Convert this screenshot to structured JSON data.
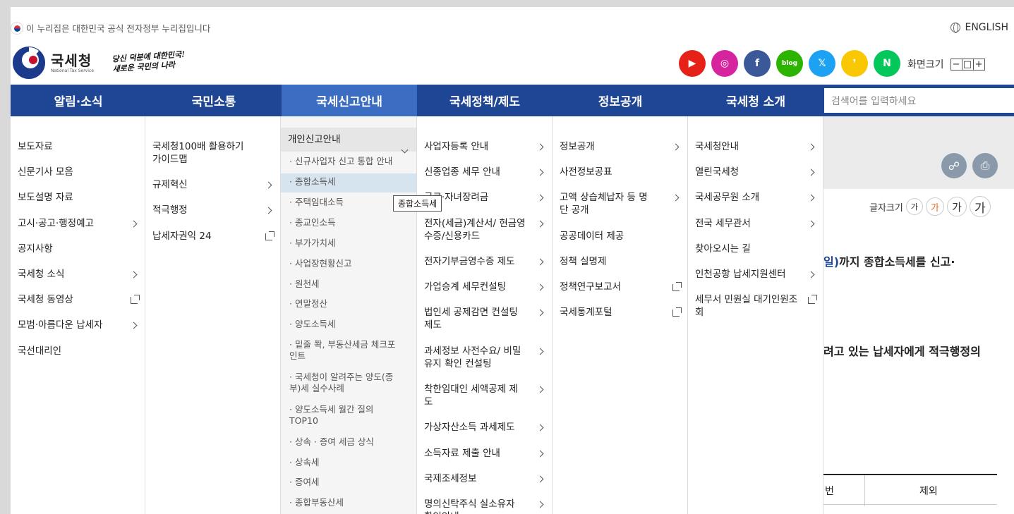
{
  "top": {
    "gov_notice": "이 누리집은 대한민국 공식 전자정부 누리집입니다",
    "english": "ENGLISH",
    "logo_kr": "국세청",
    "logo_en": "National Tax Service",
    "slogan_line1": "당신 덕분에 대한민국!",
    "slogan_line2": "새로운 국민의 나라",
    "screen_size_label": "화면크기",
    "zoom_out": "−",
    "zoom_reset": "□",
    "zoom_in": "+"
  },
  "social": [
    {
      "name": "youtube",
      "glyph": "▶",
      "color": "#e62117"
    },
    {
      "name": "instagram",
      "glyph": "◎",
      "color": "#d6249f"
    },
    {
      "name": "facebook",
      "glyph": "f",
      "color": "#3b5998"
    },
    {
      "name": "blog",
      "glyph": "blog",
      "color": "#2db400"
    },
    {
      "name": "x",
      "glyph": "𝕏",
      "color": "#1da1f2"
    },
    {
      "name": "kakao",
      "glyph": "❜",
      "color": "#f9c802"
    },
    {
      "name": "naver-post",
      "glyph": "N",
      "color": "#03c75a"
    }
  ],
  "nav": {
    "items": [
      "알림·소식",
      "국민소통",
      "국세신고안내",
      "국세정책/제도",
      "정보공개",
      "국세청 소개"
    ],
    "active_index": 2,
    "search_placeholder": "검색어를 입력하세요"
  },
  "menu": {
    "col1": [
      "보도자료",
      "신문기사 모음",
      "보도설명 자료",
      "고시·공고·행정예고",
      "공지사항",
      "국세청 소식",
      "국세청 동영상",
      "모범·아름다운 납세자",
      "국선대리인"
    ],
    "col2": [
      "국세청100배 활용하기 가이드맵",
      "규제혁신",
      "적극행정",
      "납세자권익 24"
    ],
    "col3_header": "개인신고안내",
    "col3": [
      "신규사업자 신고 통합 안내",
      "종합소득세",
      "주택임대소득",
      "종교인소득",
      "부가가치세",
      "사업장현황신고",
      "원천세",
      "연말정산",
      "양도소득세",
      "밑줄 쫙, 부동산세금 체크포인트",
      "국세청이 알려주는 양도(종부)세 실수사례",
      "양도소득세 월간 질의 TOP10",
      "상속 · 증여 세금 상식",
      "상속세",
      "증여세",
      "종합부동산세"
    ],
    "col4": [
      "사업자등록 안내",
      "신종업종 세무 안내",
      "근로·자녀장려금",
      "전자(세금)계산서/ 현금영수증/신용카드",
      "전자기부금영수증 제도",
      "가업승계 세무컨설팅",
      "법인세 공제감면 컨설팅 제도",
      "과세정보 사전수요/ 비밀유지 확인 컨설팅",
      "착한임대인 세액공제 제도",
      "가상자산소득 과세제도",
      "소득자료 제출 안내",
      "국제조세정보",
      "명의신탁주식 실소유자 확인안내"
    ],
    "col5": [
      "정보공개",
      "사전정보공표",
      "고액 상습체납자 등 명단 공개",
      "공공데이터 제공",
      "정책 실명제",
      "정책연구보고서",
      "국세통계포털"
    ],
    "col6": [
      "국세청안내",
      "열린국세청",
      "국세공무원 소개",
      "전국 세무관서",
      "찾아오시는 길",
      "인천공항 납세지원센터",
      "세무서 민원실 대기인원조회"
    ],
    "tooltip": "종합소득세"
  },
  "background": {
    "font_size_label": "글자크기",
    "font_size_options": [
      "가",
      "가",
      "가",
      "가"
    ],
    "text1_blue": "일)",
    "text1_rest": "까지 종합소득세를 신고·",
    "text2": "려고 있는 납세자에게 적극행정의",
    "table_col_a": "번",
    "table_col_b": "제외"
  }
}
